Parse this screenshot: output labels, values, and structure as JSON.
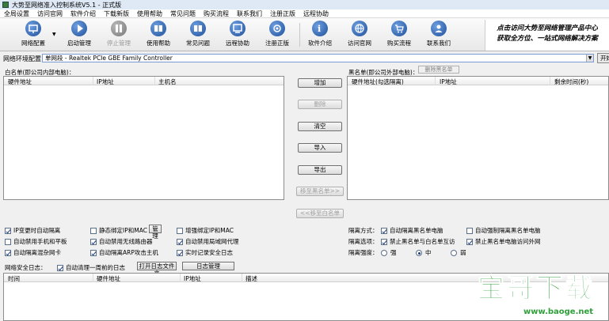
{
  "window": {
    "title": "大势至网络准入控制系统V5.1 - 正式版"
  },
  "menu": [
    "全局设置",
    "访问官网",
    "软件介绍",
    "下载新版",
    "使用帮助",
    "常见问题",
    "购买流程",
    "联系我们",
    "注册正版",
    "远程协助"
  ],
  "toolbar": {
    "buttons": [
      {
        "label": "网络配置",
        "icon": "network-icon",
        "enabled": true
      },
      {
        "label": "启动管理",
        "icon": "play-icon",
        "enabled": true
      },
      {
        "label": "停止管理",
        "icon": "pause-icon",
        "enabled": false
      },
      {
        "label": "使用帮助",
        "icon": "help-icon",
        "enabled": true
      },
      {
        "label": "常见问题",
        "icon": "faq-icon",
        "enabled": true
      },
      {
        "label": "远程协助",
        "icon": "remote-icon",
        "enabled": true
      },
      {
        "label": "注册正版",
        "icon": "register-icon",
        "enabled": true
      },
      {
        "label": "软件介绍",
        "icon": "info-icon",
        "enabled": true
      },
      {
        "label": "访问官网",
        "icon": "globe-icon",
        "enabled": true
      },
      {
        "label": "购买流程",
        "icon": "cart-icon",
        "enabled": true
      },
      {
        "label": "联系我们",
        "icon": "contact-icon",
        "enabled": true
      }
    ],
    "banner_line1": "点击访问大势至网络管理产品中心",
    "banner_line2": "获取全方位、一站式网络解决方案"
  },
  "network": {
    "label": "网络环境配置：",
    "selected": "单网段 - Realtek PCIe GBE Family Controller",
    "start_label": "开始"
  },
  "whitelist": {
    "title": "白名单(即公司内部电脑)：",
    "columns": [
      "硬件地址",
      "IP地址",
      "主机名"
    ]
  },
  "blacklist": {
    "title": "黑名单(即公司外部电脑)：",
    "delete_button": "删除黑名单",
    "columns": [
      "硬件地址(勾选隔离)",
      "IP地址",
      "剩余时间(秒)"
    ]
  },
  "mid_buttons": [
    {
      "label": "增加",
      "enabled": true
    },
    {
      "label": "删除",
      "enabled": false
    },
    {
      "label": "清空",
      "enabled": true
    },
    {
      "label": "导入",
      "enabled": true
    },
    {
      "label": "导出",
      "enabled": true
    },
    {
      "label": "移至黑名单>>",
      "enabled": false
    },
    {
      "label": "<<移至白名单",
      "enabled": false
    }
  ],
  "options_left": [
    {
      "label": "IP变更时自动隔离",
      "checked": true
    },
    {
      "label": "静态绑定IP和MAC",
      "checked": false
    },
    {
      "label": "增强绑定IP和MAC",
      "checked": false
    },
    {
      "label": "自动禁用手机和平板",
      "checked": false
    },
    {
      "label": "自动禁用无线路由器",
      "checked": true
    },
    {
      "label": "自动禁用局域网代理",
      "checked": true
    },
    {
      "label": "自动隔离混杂网卡",
      "checked": true
    },
    {
      "label": "自动隔离ARP攻击主机",
      "checked": true
    },
    {
      "label": "实时记录安全日志",
      "checked": true
    }
  ],
  "manage_button": "管理",
  "isolation": {
    "mode_label": "隔离方式：",
    "mode_opt1": {
      "label": "自动隔离黑名单电脑",
      "checked": true
    },
    "mode_opt2": {
      "label": "自动强制隔离黑名单电脑",
      "checked": false
    },
    "options_label": "隔离选项：",
    "opt1": {
      "label": "禁止黑名单与白名单互访",
      "checked": true
    },
    "opt2": {
      "label": "禁止黑名单电脑访问外网",
      "checked": true
    },
    "strength_label": "隔离强度：",
    "strength": [
      "强",
      "中",
      "弱"
    ],
    "strength_selected": "中"
  },
  "log": {
    "label": "网络安全日志：",
    "auto_clean": {
      "label": "自动清理一周前的日志",
      "checked": true
    },
    "open_folder": "打开日志文件夹",
    "manage": "日志管理",
    "columns": [
      "时间",
      "硬件地址",
      "IP地址",
      "描述"
    ]
  },
  "watermark": {
    "title": "宝哥下载",
    "url": "www.baoge.net"
  }
}
